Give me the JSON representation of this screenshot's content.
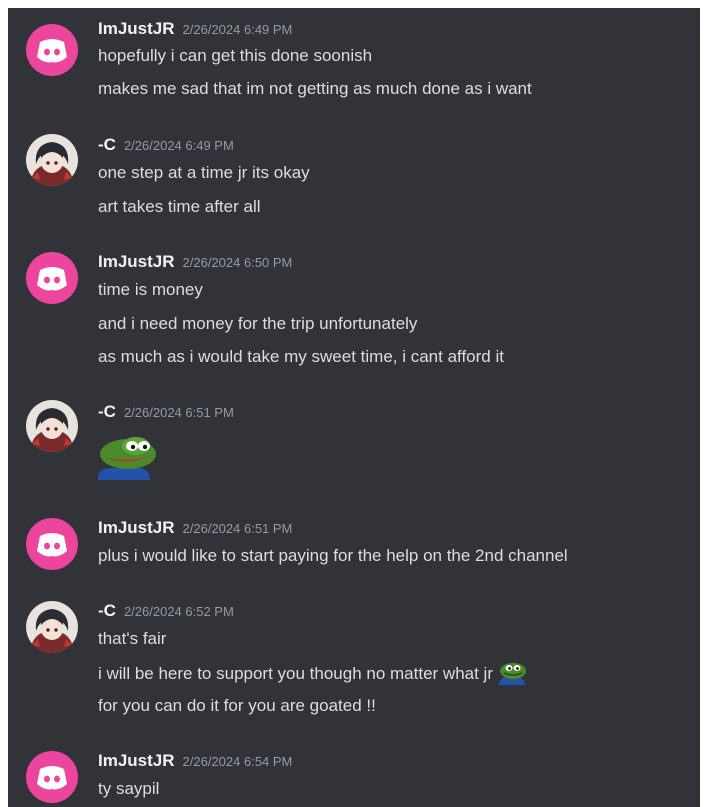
{
  "messages": [
    {
      "author": "ImJustJR",
      "timestamp": "2/26/2024 6:49 PM",
      "avatar": "discord-logo-icon",
      "lines": [
        "hopefully i can get this done soonish",
        "makes me sad that im not getting as much done as i want"
      ]
    },
    {
      "author": "-C",
      "timestamp": "2/26/2024 6:49 PM",
      "avatar": "anime-character-avatar",
      "lines": [
        "one step at a time jr its okay",
        "art takes time after all"
      ]
    },
    {
      "author": "ImJustJR",
      "timestamp": "2/26/2024 6:50 PM",
      "avatar": "discord-logo-icon",
      "lines": [
        "time is money",
        "and i need money for the trip unfortunately",
        "as much as i would take my sweet time, i cant afford it"
      ]
    },
    {
      "author": "-C",
      "timestamp": "2/26/2024 6:51 PM",
      "avatar": "anime-character-avatar",
      "emoji": "pepe-frog-emoji"
    },
    {
      "author": "ImJustJR",
      "timestamp": "2/26/2024 6:51 PM",
      "avatar": "discord-logo-icon",
      "lines": [
        "plus i would like to start paying for the help on the 2nd channel"
      ]
    },
    {
      "author": "-C",
      "timestamp": "2/26/2024 6:52 PM",
      "avatar": "anime-character-avatar",
      "lines": [
        "that's fair",
        "i will be here to support you though no matter what jr",
        "for you can do it for you are goated !!"
      ],
      "inline_emoji": "pepe-frog-emoji"
    },
    {
      "author": "ImJustJR",
      "timestamp": "2/26/2024 6:54 PM",
      "avatar": "discord-logo-icon",
      "lines": [
        "ty saypil"
      ]
    }
  ],
  "colors": {
    "background": "#313338",
    "discord_avatar": "#eb459e",
    "author": "#f2f3f5",
    "timestamp": "#949ba4",
    "text": "#dbdee1"
  }
}
